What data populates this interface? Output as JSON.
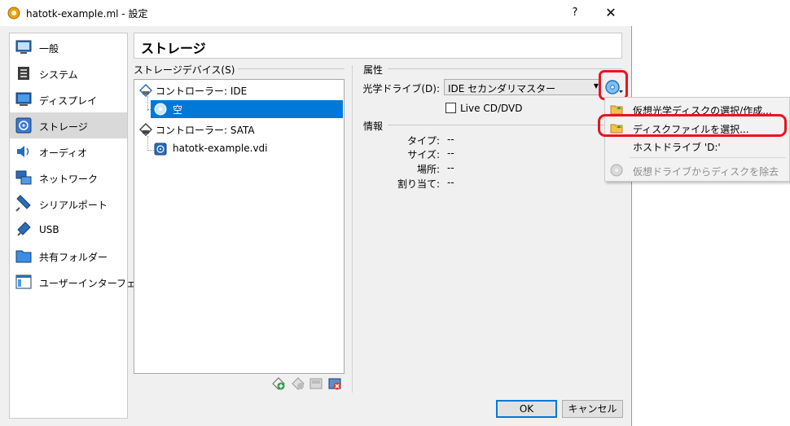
{
  "window": {
    "title": "hatotk-example.ml - 設定",
    "help_label": "?",
    "close_label": "✕"
  },
  "nav": {
    "items": [
      {
        "label": "一般",
        "icon": "general-icon"
      },
      {
        "label": "システム",
        "icon": "system-icon"
      },
      {
        "label": "ディスプレイ",
        "icon": "display-icon"
      },
      {
        "label": "ストレージ",
        "icon": "storage-icon",
        "selected": true
      },
      {
        "label": "オーディオ",
        "icon": "audio-icon"
      },
      {
        "label": "ネットワーク",
        "icon": "network-icon"
      },
      {
        "label": "シリアルポート",
        "icon": "serial-port-icon"
      },
      {
        "label": "USB",
        "icon": "usb-icon"
      },
      {
        "label": "共有フォルダー",
        "icon": "shared-folder-icon"
      },
      {
        "label": "ユーザーインターフェース",
        "icon": "user-interface-icon"
      }
    ]
  },
  "page_title": "ストレージ",
  "storage": {
    "devices_label": "ストレージデバイス(S)",
    "tree": {
      "controller_ide": "コントローラー: IDE",
      "ide_empty": "空",
      "controller_sata": "コントローラー: SATA",
      "sata_disk": "hatotk-example.vdi"
    }
  },
  "attributes": {
    "section_label": "属性",
    "optical_drive_label": "光学ドライブ(D):",
    "optical_drive_value": "IDE セカンダリマスター",
    "live_cd_label": "Live CD/DVD",
    "live_cd_checked": false
  },
  "info": {
    "section_label": "情報",
    "rows": [
      {
        "label": "タイプ:",
        "value": "--"
      },
      {
        "label": "サイズ:",
        "value": "--"
      },
      {
        "label": "場所:",
        "value": "--"
      },
      {
        "label": "割り当て:",
        "value": "--"
      }
    ]
  },
  "popup_menu": {
    "items": [
      {
        "label": "仮想光学ディスクの選択/作成...",
        "icon": "folder-choose-icon",
        "enabled": true
      },
      {
        "label": "ディスクファイルを選択...",
        "icon": "folder-open-icon",
        "enabled": true
      },
      {
        "label": "ホストドライブ 'D:'",
        "icon": "",
        "enabled": true
      },
      {
        "label": "仮想ドライブからディスクを除去",
        "icon": "eject-disk-icon",
        "enabled": false
      }
    ]
  },
  "buttons": {
    "ok": "OK",
    "cancel": "キャンセル"
  },
  "colors": {
    "selection": "#0078d7",
    "highlight_ring": "#e8141f",
    "dialog_bg": "#f0f0f0"
  }
}
